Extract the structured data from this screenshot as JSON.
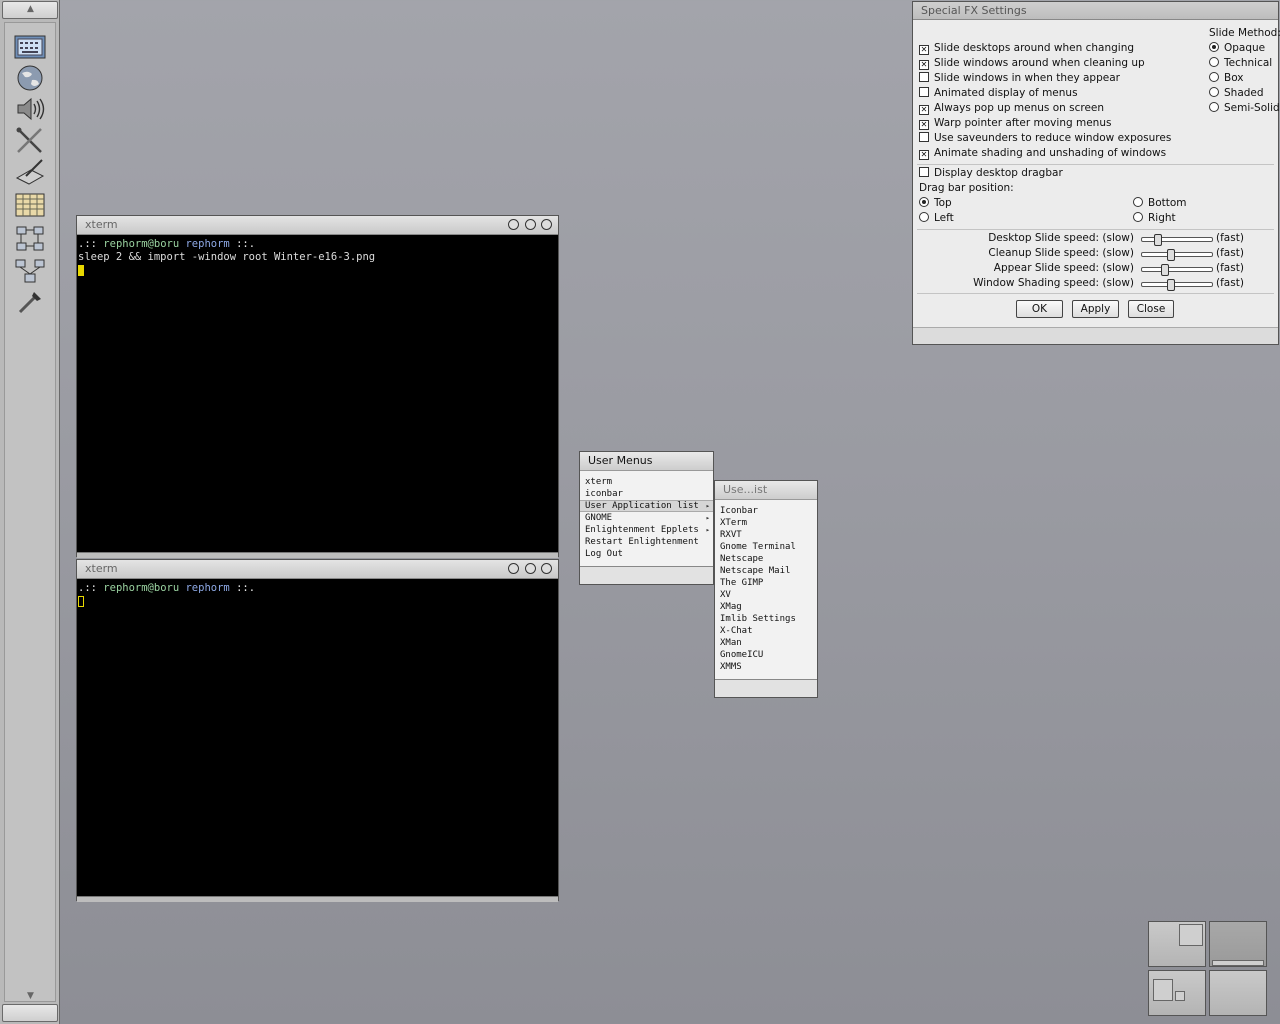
{
  "iconbar": {
    "icons": [
      "keyboard-icon",
      "globe-icon",
      "speaker-icon",
      "tools-icon",
      "editor-icon",
      "spreadsheet-icon",
      "network-icon",
      "network-alt-icon",
      "eyedropper-icon"
    ]
  },
  "xterm1": {
    "title": "xterm",
    "prompt_prefix": ".:: ",
    "user": "rephorm@boru",
    "dir": "rephorm",
    "prompt_suffix": " ::.",
    "command": "sleep 2 && import -window root Winter-e16-3.png"
  },
  "xterm2": {
    "title": "xterm",
    "prompt_prefix": ".:: ",
    "user": "rephorm@boru",
    "dir": "rephorm",
    "prompt_suffix": " ::."
  },
  "fx": {
    "title": "Special FX Settings",
    "options": [
      {
        "label": "Slide desktops around when changing",
        "checked": true
      },
      {
        "label": "Slide windows around when cleaning up",
        "checked": true
      },
      {
        "label": "Slide windows in when they appear",
        "checked": false
      },
      {
        "label": "Animated display of menus",
        "checked": false
      },
      {
        "label": "Always pop up menus on screen",
        "checked": true
      },
      {
        "label": "Warp pointer after moving menus",
        "checked": true
      },
      {
        "label": "Use saveunders to reduce window exposures",
        "checked": false
      },
      {
        "label": "Animate shading and unshading of windows",
        "checked": true
      }
    ],
    "slide_method_label": "Slide Method:",
    "slide_methods": [
      {
        "label": "Opaque",
        "selected": true
      },
      {
        "label": "Technical",
        "selected": false
      },
      {
        "label": "Box",
        "selected": false
      },
      {
        "label": "Shaded",
        "selected": false
      },
      {
        "label": "Semi-Solid",
        "selected": false
      }
    ],
    "dragbar_label": "Display desktop dragbar",
    "dragbar_checked": false,
    "dragbar_pos_label": "Drag bar position:",
    "dragbar_positions": [
      {
        "label": "Top",
        "selected": true
      },
      {
        "label": "Bottom",
        "selected": false
      },
      {
        "label": "Left",
        "selected": false
      },
      {
        "label": "Right",
        "selected": false
      }
    ],
    "speeds": [
      {
        "label": "Desktop Slide speed: (slow)",
        "value": 0.2
      },
      {
        "label": "Cleanup Slide speed: (slow)",
        "value": 0.4
      },
      {
        "label": "Appear Slide speed: (slow)",
        "value": 0.3
      },
      {
        "label": "Window Shading speed: (slow)",
        "value": 0.4
      }
    ],
    "fast_label": "(fast)",
    "ok": "OK",
    "apply": "Apply",
    "close": "Close"
  },
  "user_menu": {
    "title": "User Menus",
    "items": [
      {
        "label": "xterm",
        "submenu": false
      },
      {
        "label": "iconbar",
        "submenu": false
      },
      {
        "label": "User Application list",
        "submenu": true
      },
      {
        "label": "GNOME",
        "submenu": true
      },
      {
        "label": "Enlightenment Epplets",
        "submenu": true
      },
      {
        "label": "Restart Enlightenment",
        "submenu": false
      },
      {
        "label": "Log Out",
        "submenu": false
      }
    ]
  },
  "app_menu": {
    "title": "Use...ist",
    "items": [
      "Iconbar",
      "XTerm",
      "RXVT",
      "Gnome Terminal",
      "Netscape",
      "Netscape Mail",
      "The GIMP",
      "XV",
      "XMag",
      "Imlib Settings",
      "X-Chat",
      "XMan",
      "GnomeICU",
      "XMMS"
    ]
  },
  "colors": {
    "terminal_cursor": "#e8d800"
  }
}
